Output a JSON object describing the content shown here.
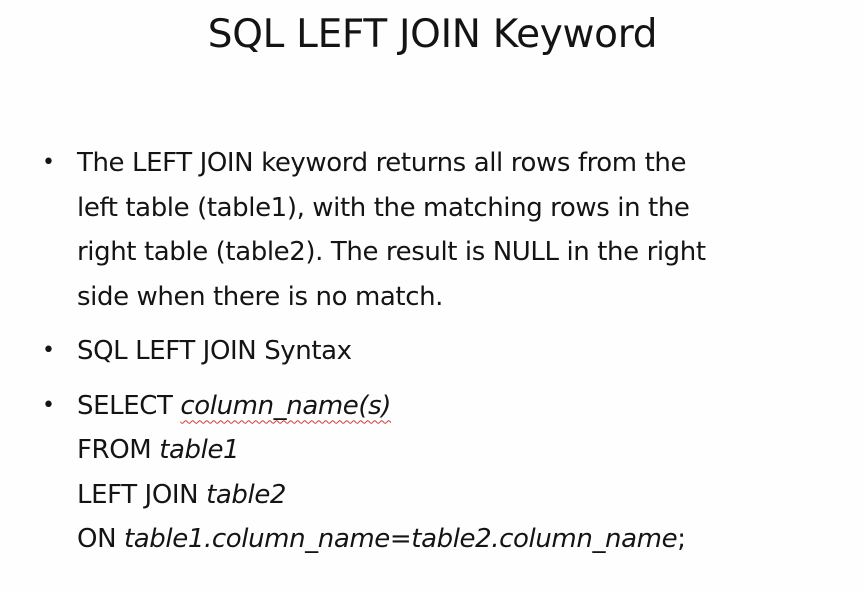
{
  "slide": {
    "title": "SQL LEFT JOIN Keyword",
    "bullet_marker": "•",
    "bullet1": {
      "lines": [
        "The LEFT JOIN keyword returns all rows from the",
        "left table (table1), with the matching rows in the",
        "right table (table2). The result is NULL in the right",
        "side when there is no match."
      ]
    },
    "bullet2": {
      "text": "SQL LEFT JOIN Syntax"
    },
    "bullet3": {
      "select_kw": "SELECT ",
      "select_arg": "column_name(s)",
      "from_kw": "FROM ",
      "from_arg": "table1",
      "join_kw": "LEFT JOIN ",
      "join_arg": "table2",
      "on_kw": "ON ",
      "on_arg": "table1.column_name=table2.column_name",
      "terminator": ";"
    }
  }
}
